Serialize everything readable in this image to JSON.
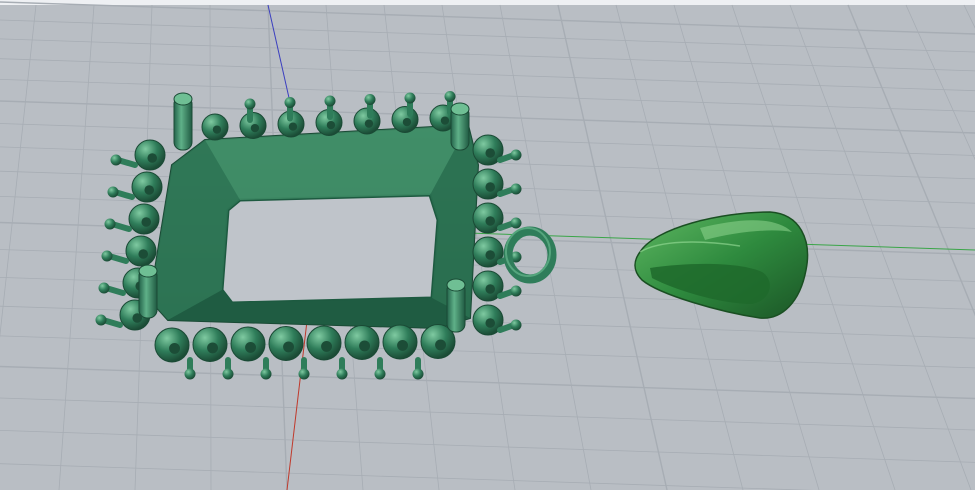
{
  "viewport": {
    "view_type": "perspective",
    "grid_visible": true,
    "background_color": "#b9bec4",
    "grid_color": "#a7adb4",
    "axis_colors": {
      "x": "#3aa548",
      "y": "#c0392b",
      "z": "#3b3fbf"
    }
  },
  "scene": {
    "objects": [
      {
        "name": "pendant-halo-setting",
        "color": "#2f7d5a",
        "highlight": "#6fbf94",
        "shadow": "#1d4f39"
      },
      {
        "name": "pendant-bail",
        "color": "#2e8a3e",
        "highlight": "#79c779",
        "shadow": "#1d5a27"
      }
    ]
  }
}
